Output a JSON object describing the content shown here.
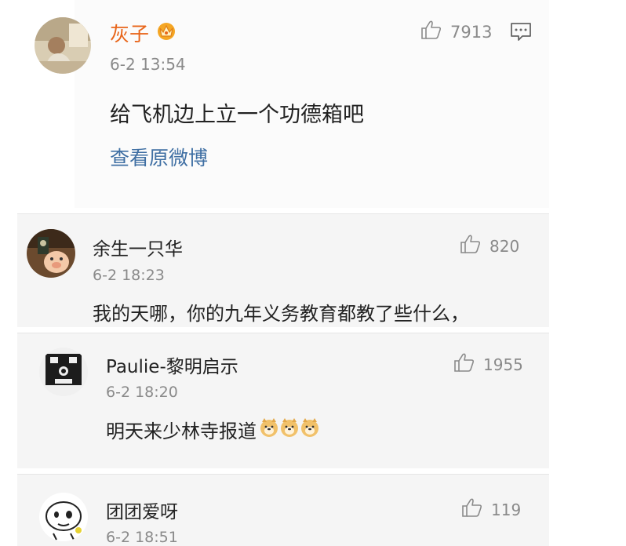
{
  "main_post": {
    "username": "灰子",
    "timestamp": "6-2 13:54",
    "like_count": "7913",
    "content": "给飞机边上立一个功德箱吧",
    "view_original_link": "查看原微博",
    "badge_icon": "crown-badge-icon",
    "comment_icon": "comment-icon"
  },
  "comments": [
    {
      "username": "余生一只华",
      "timestamp": "6-2 18:23",
      "like_count": "820",
      "content": "我的天哪，你的九年义务教育都教了些什么，"
    },
    {
      "username": "Paulie-黎明启示",
      "timestamp": "6-2 18:20",
      "like_count": "1955",
      "content": "明天来少林寺报道",
      "emoji": [
        "doge-emoji",
        "doge-emoji",
        "doge-emoji"
      ]
    },
    {
      "username": "团团爱呀",
      "timestamp": "6-2 18:51",
      "like_count": "119"
    }
  ],
  "colors": {
    "link": "#3f6fa3",
    "username_main": "#e8651a",
    "muted": "#8a8a8a",
    "card_bg": "#f6f6f6"
  }
}
